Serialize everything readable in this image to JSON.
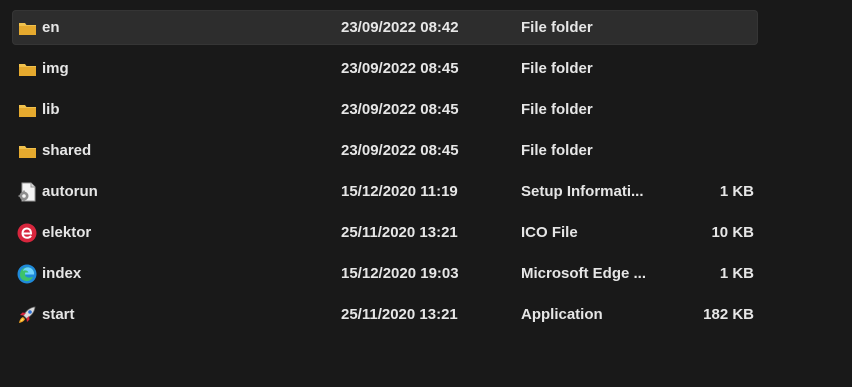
{
  "files": [
    {
      "name": "en",
      "date": "23/09/2022 08:42",
      "type": "File folder",
      "size": "",
      "icon": "folder-icon",
      "selected": true
    },
    {
      "name": "img",
      "date": "23/09/2022 08:45",
      "type": "File folder",
      "size": "",
      "icon": "folder-icon",
      "selected": false
    },
    {
      "name": "lib",
      "date": "23/09/2022 08:45",
      "type": "File folder",
      "size": "",
      "icon": "folder-icon",
      "selected": false
    },
    {
      "name": "shared",
      "date": "23/09/2022 08:45",
      "type": "File folder",
      "size": "",
      "icon": "folder-icon",
      "selected": false
    },
    {
      "name": "autorun",
      "date": "15/12/2020 11:19",
      "type": "Setup Informati...",
      "size": "1 KB",
      "icon": "setup-info-icon",
      "selected": false
    },
    {
      "name": "elektor",
      "date": "25/11/2020 13:21",
      "type": "ICO File",
      "size": "10 KB",
      "icon": "elektor-logo-icon",
      "selected": false
    },
    {
      "name": "index",
      "date": "15/12/2020 19:03",
      "type": "Microsoft Edge ...",
      "size": "1 KB",
      "icon": "edge-icon",
      "selected": false
    },
    {
      "name": "start",
      "date": "25/11/2020 13:21",
      "type": "Application",
      "size": "182 KB",
      "icon": "application-icon",
      "selected": false
    }
  ],
  "colors": {
    "background": "#191919",
    "selected_row": "#2d2d2d",
    "text": "#e6e6e6",
    "folder": "#f0c14d",
    "elektor": "#d7263d",
    "edge": "#1f8ad9"
  }
}
